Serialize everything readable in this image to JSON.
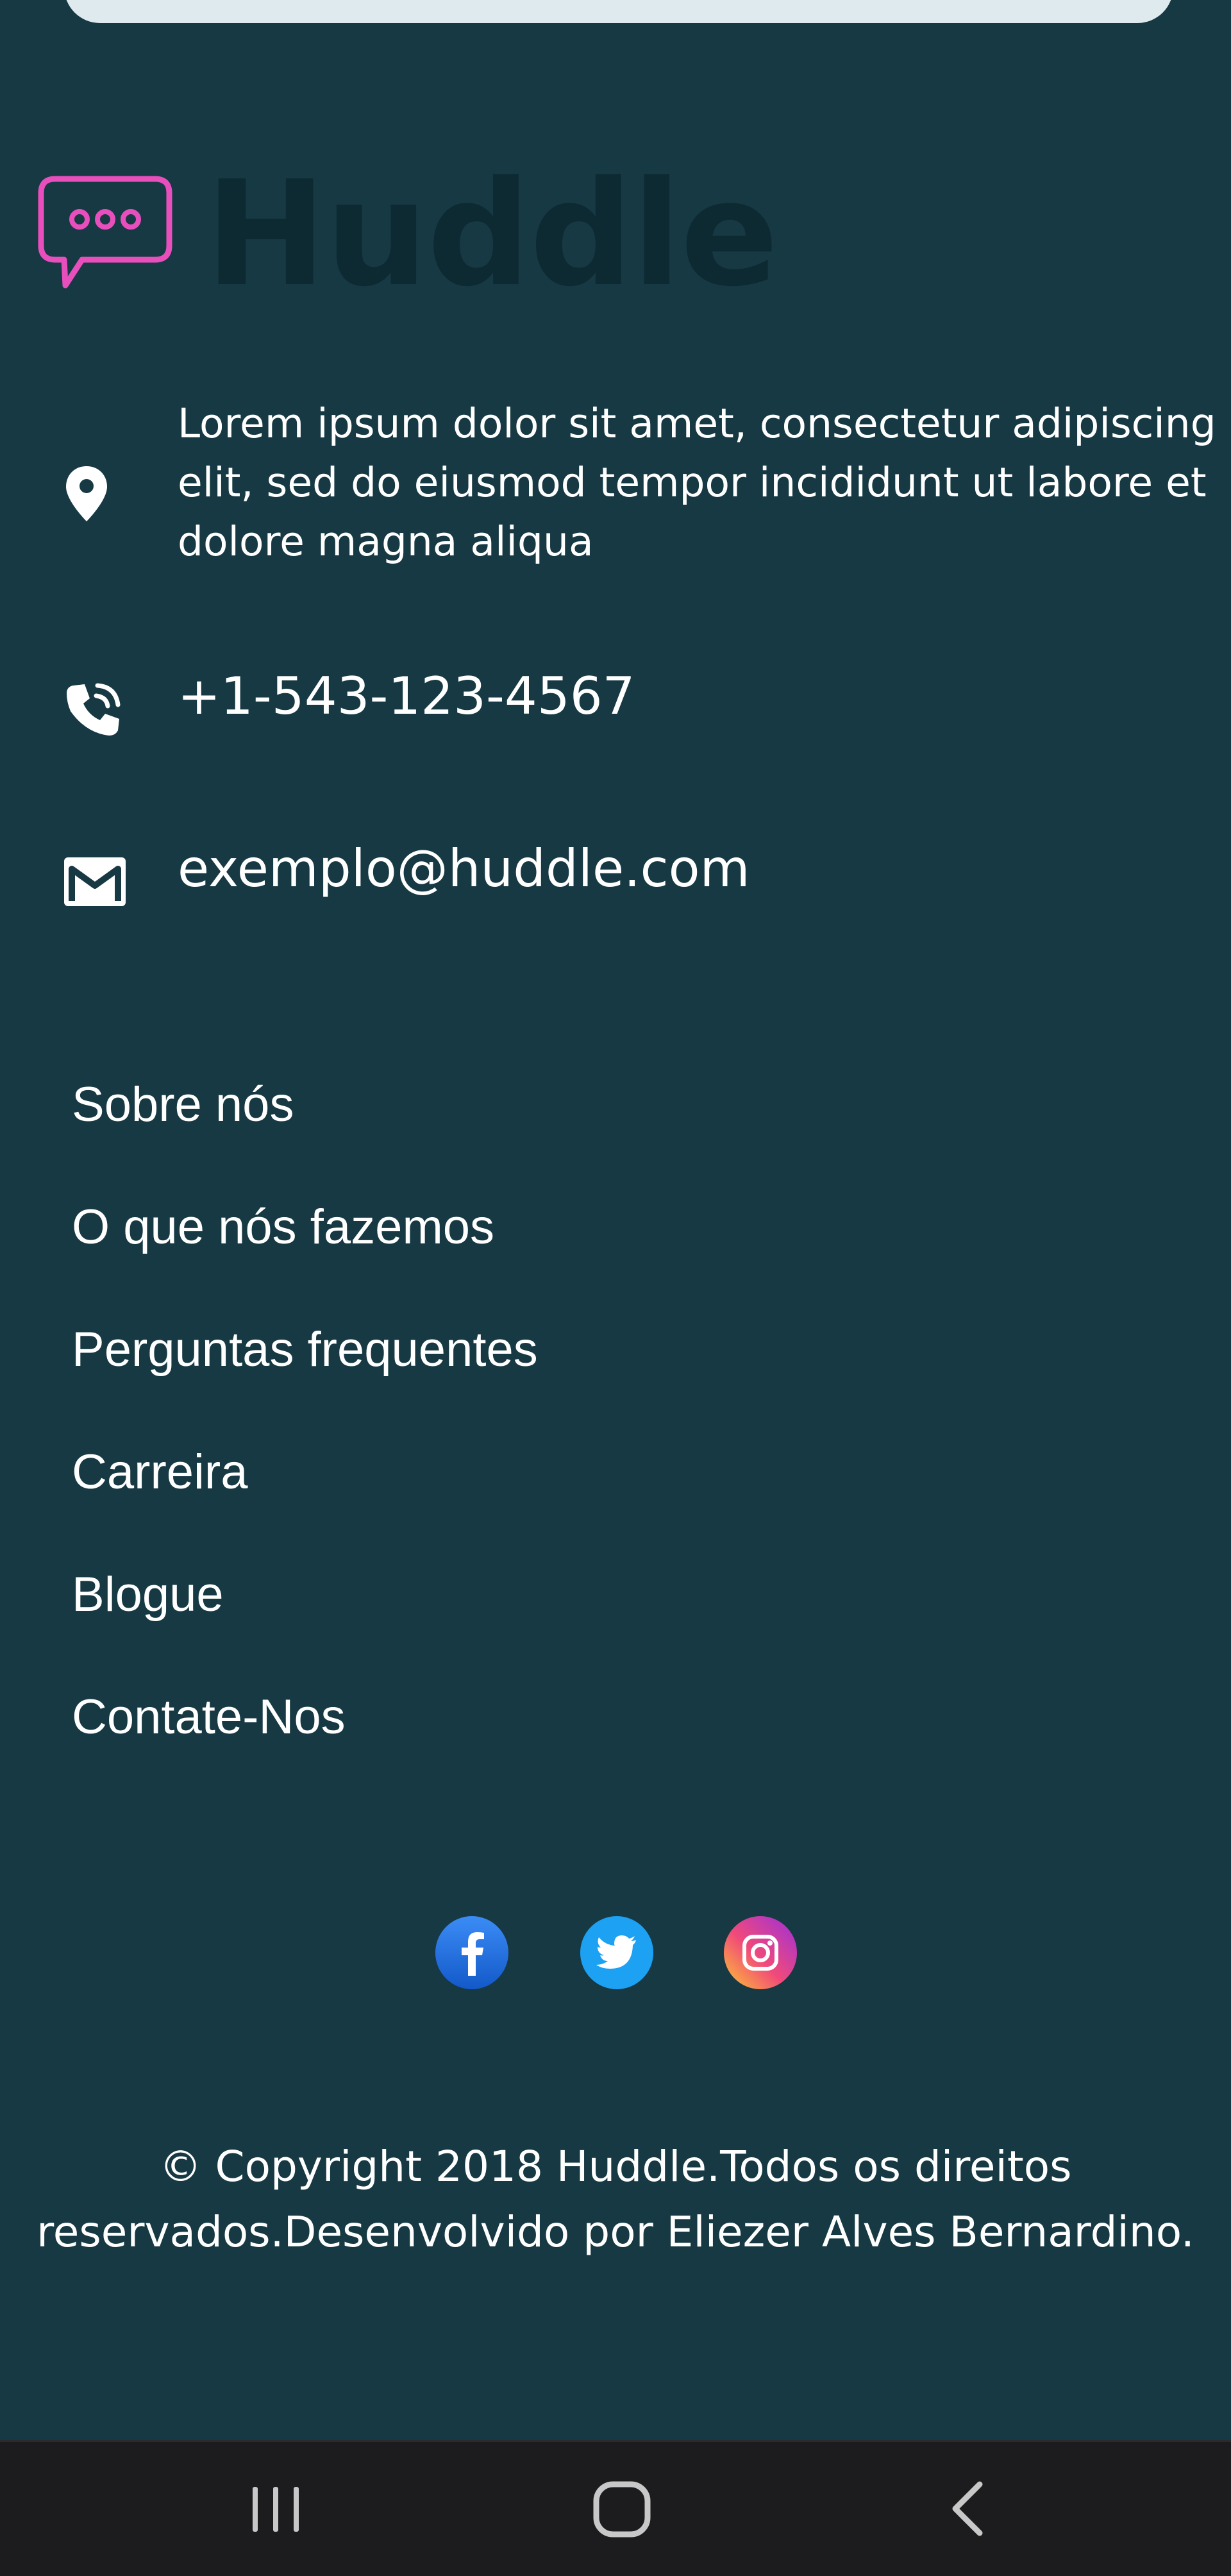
{
  "brand": {
    "name": "Huddle",
    "logo_icon": "speech-bubble-icon",
    "accent_color": "#e84fbd",
    "wordmark_color": "#0d2a33"
  },
  "colors": {
    "background": "#173943",
    "top_card": "#dfeaee",
    "text": "#ffffff",
    "system_nav": "#1c1c1e"
  },
  "contact": {
    "address": "Lorem ipsum dolor sit amet, consectetur adipiscing elit, sed do eiusmod tempor incididunt ut labore et dolore magna aliqua",
    "address_icon": "location-pin-icon",
    "phone": "+1-543-123-4567",
    "phone_icon": "phone-icon",
    "email": "exemplo@huddle.com",
    "email_icon": "email-icon"
  },
  "nav": {
    "items": [
      {
        "label": "Sobre nós"
      },
      {
        "label": "O que nós fazemos"
      },
      {
        "label": "Perguntas frequentes"
      },
      {
        "label": "Carreira"
      },
      {
        "label": "Blogue"
      },
      {
        "label": "Contate-Nos"
      }
    ]
  },
  "social": [
    {
      "icon": "facebook-icon",
      "color": "#1877f2"
    },
    {
      "icon": "twitter-icon",
      "color": "#1da1f2"
    },
    {
      "icon": "instagram-icon",
      "color": "#d6249f"
    }
  ],
  "copyright": {
    "line1": "© Copyright 2018 Huddle.Todos os direitos",
    "line2": "reservados.Desenvolvido por Eliezer Alves Bernardino."
  },
  "system_nav": {
    "recents_icon": "recent-apps-icon",
    "home_icon": "home-icon",
    "back_icon": "back-icon"
  }
}
